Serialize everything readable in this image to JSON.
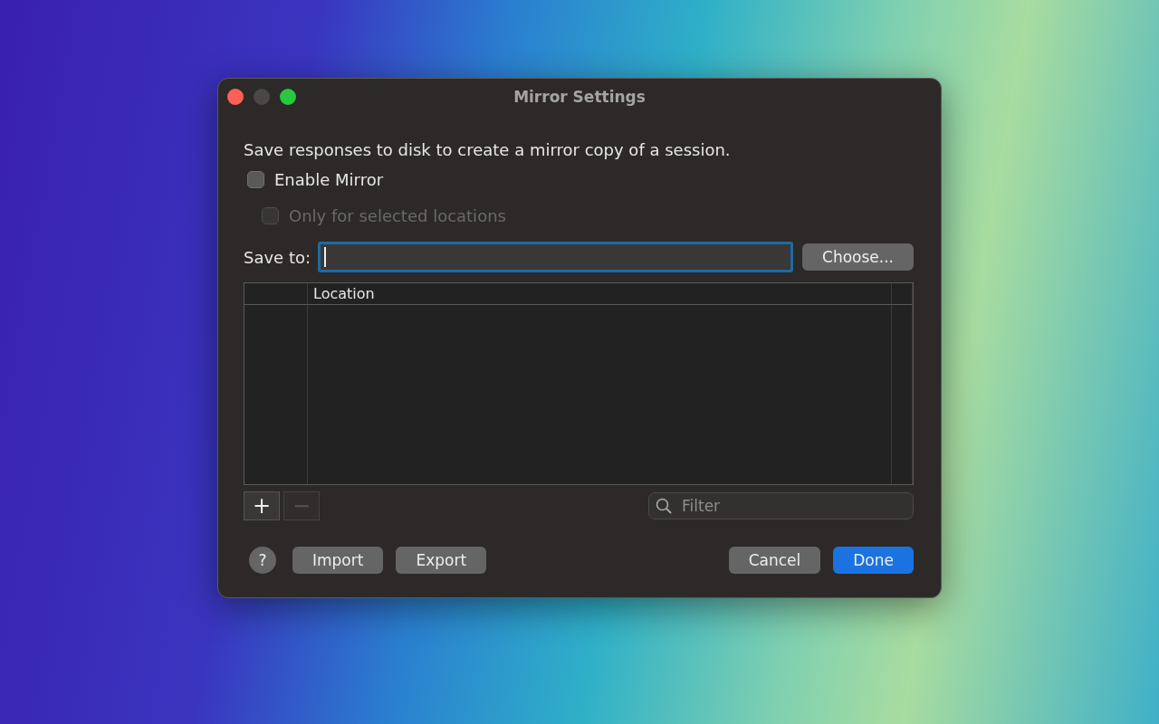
{
  "window": {
    "title": "Mirror Settings"
  },
  "description": "Save responses to disk to create a mirror copy of a session.",
  "options": [
    {
      "label": "Enable Mirror",
      "checked": false,
      "disabled": false
    },
    {
      "label": "Only for selected locations",
      "checked": false,
      "disabled": true
    }
  ],
  "save_to": {
    "label": "Save to:",
    "focused": true
  },
  "choose_button": "Choose...",
  "table": {
    "columns": [
      "Location"
    ]
  },
  "table_buttons": [
    {
      "symbol": "+",
      "disabled": false
    },
    {
      "symbol": "−",
      "disabled": true
    }
  ],
  "filter": {
    "placeholder": "Filter"
  },
  "help_button": "?",
  "left_buttons": [
    "Import",
    "Export"
  ],
  "right_buttons": [
    {
      "label": "Cancel",
      "default": false
    },
    {
      "label": "Done",
      "default": true
    }
  ]
}
